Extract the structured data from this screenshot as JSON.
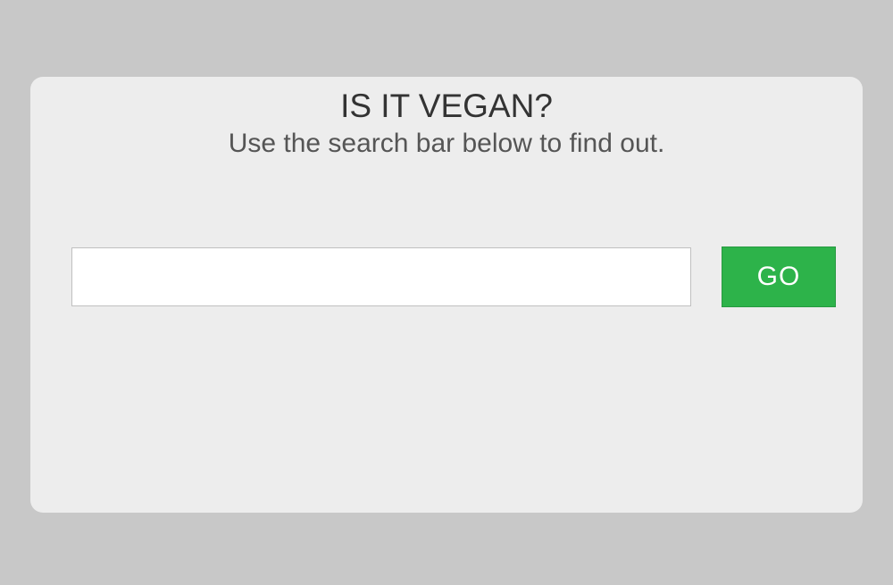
{
  "panel": {
    "heading": "IS IT VEGAN?",
    "subheading": "Use the search bar below to find out.",
    "search": {
      "value": "",
      "placeholder": ""
    },
    "go_label": "GO"
  }
}
